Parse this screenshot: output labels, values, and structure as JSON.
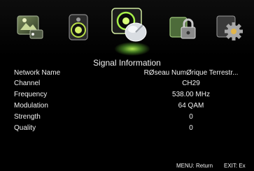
{
  "menu": {
    "items": [
      {
        "icon": "picture-icon"
      },
      {
        "icon": "sound-icon"
      },
      {
        "icon": "channel-satellite-icon",
        "active": true
      },
      {
        "icon": "lock-icon"
      },
      {
        "icon": "settings-gear-icon"
      }
    ],
    "accent_glow": "#a8f04a"
  },
  "panel": {
    "title": "Signal Information",
    "rows": [
      {
        "label": "Network Name",
        "value": "RØseau NumØrique Terrestr..."
      },
      {
        "label": "Channel",
        "value": "CH29"
      },
      {
        "label": "Frequency",
        "value": "538.00 MHz"
      },
      {
        "label": "Modulation",
        "value": "64 QAM"
      },
      {
        "label": "Strength",
        "value": "0"
      },
      {
        "label": "Quality",
        "value": "0"
      }
    ]
  },
  "footer": {
    "menu_hint": "MENU: Return",
    "exit_hint": "EXIT: Ex"
  }
}
